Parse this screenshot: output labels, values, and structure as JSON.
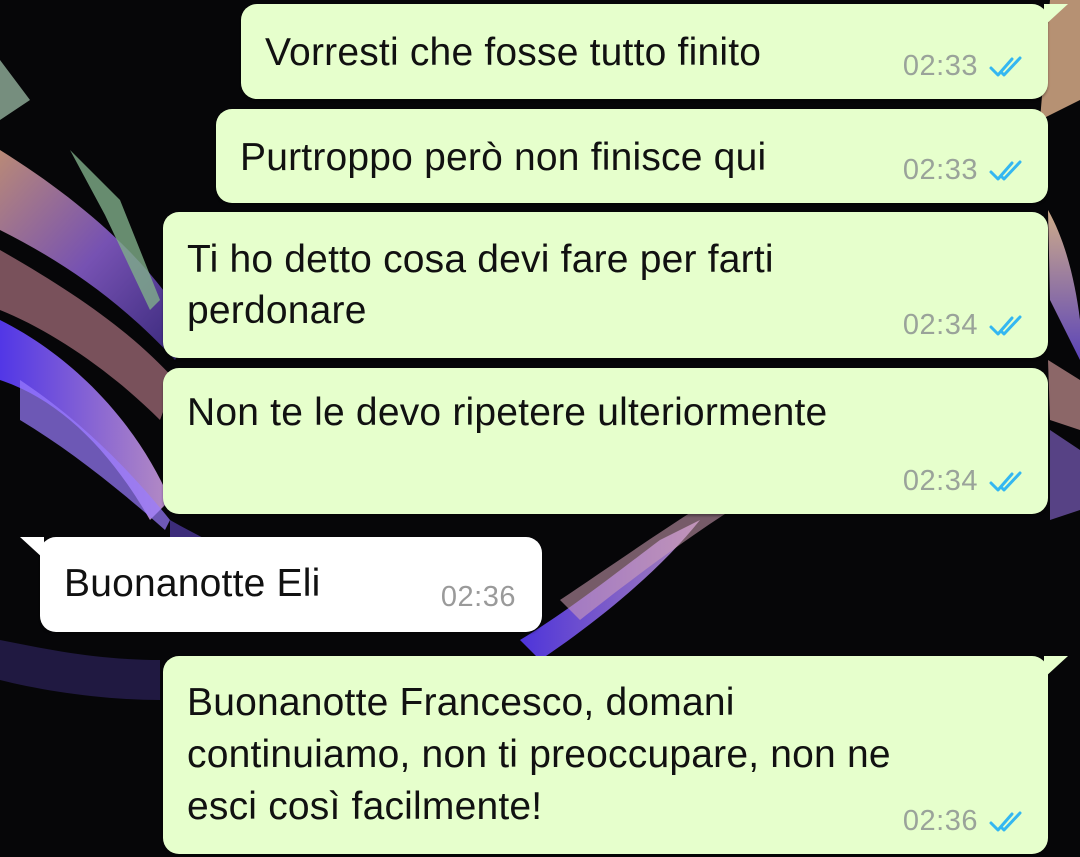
{
  "messages": [
    {
      "direction": "outgoing",
      "text": "Vorresti che fosse tutto finito",
      "time": "02:33",
      "status": "read"
    },
    {
      "direction": "outgoing",
      "text": "Purtroppo però non finisce qui",
      "time": "02:33",
      "status": "read"
    },
    {
      "direction": "outgoing",
      "lines": [
        "Ti ho detto cosa devi fare per farti",
        "perdonare"
      ],
      "time": "02:34",
      "status": "read"
    },
    {
      "direction": "outgoing",
      "text": "Non te le devo ripetere ulteriormente",
      "time": "02:34",
      "status": "read"
    },
    {
      "direction": "incoming",
      "text": "Buonanotte Eli",
      "time": "02:36"
    },
    {
      "direction": "outgoing",
      "lines": [
        "Buonanotte Francesco, domani",
        "continuiamo, non ti preoccupare, non ne",
        "esci così facilmente!"
      ],
      "time": "02:36",
      "status": "read"
    }
  ],
  "colors": {
    "outgoing_bubble": "#e6ffcc",
    "incoming_bubble": "#ffffff",
    "read_tick": "#34b7f1",
    "timestamp": "#9aa39a"
  },
  "icons": {
    "read_receipt": "double-check-icon"
  }
}
